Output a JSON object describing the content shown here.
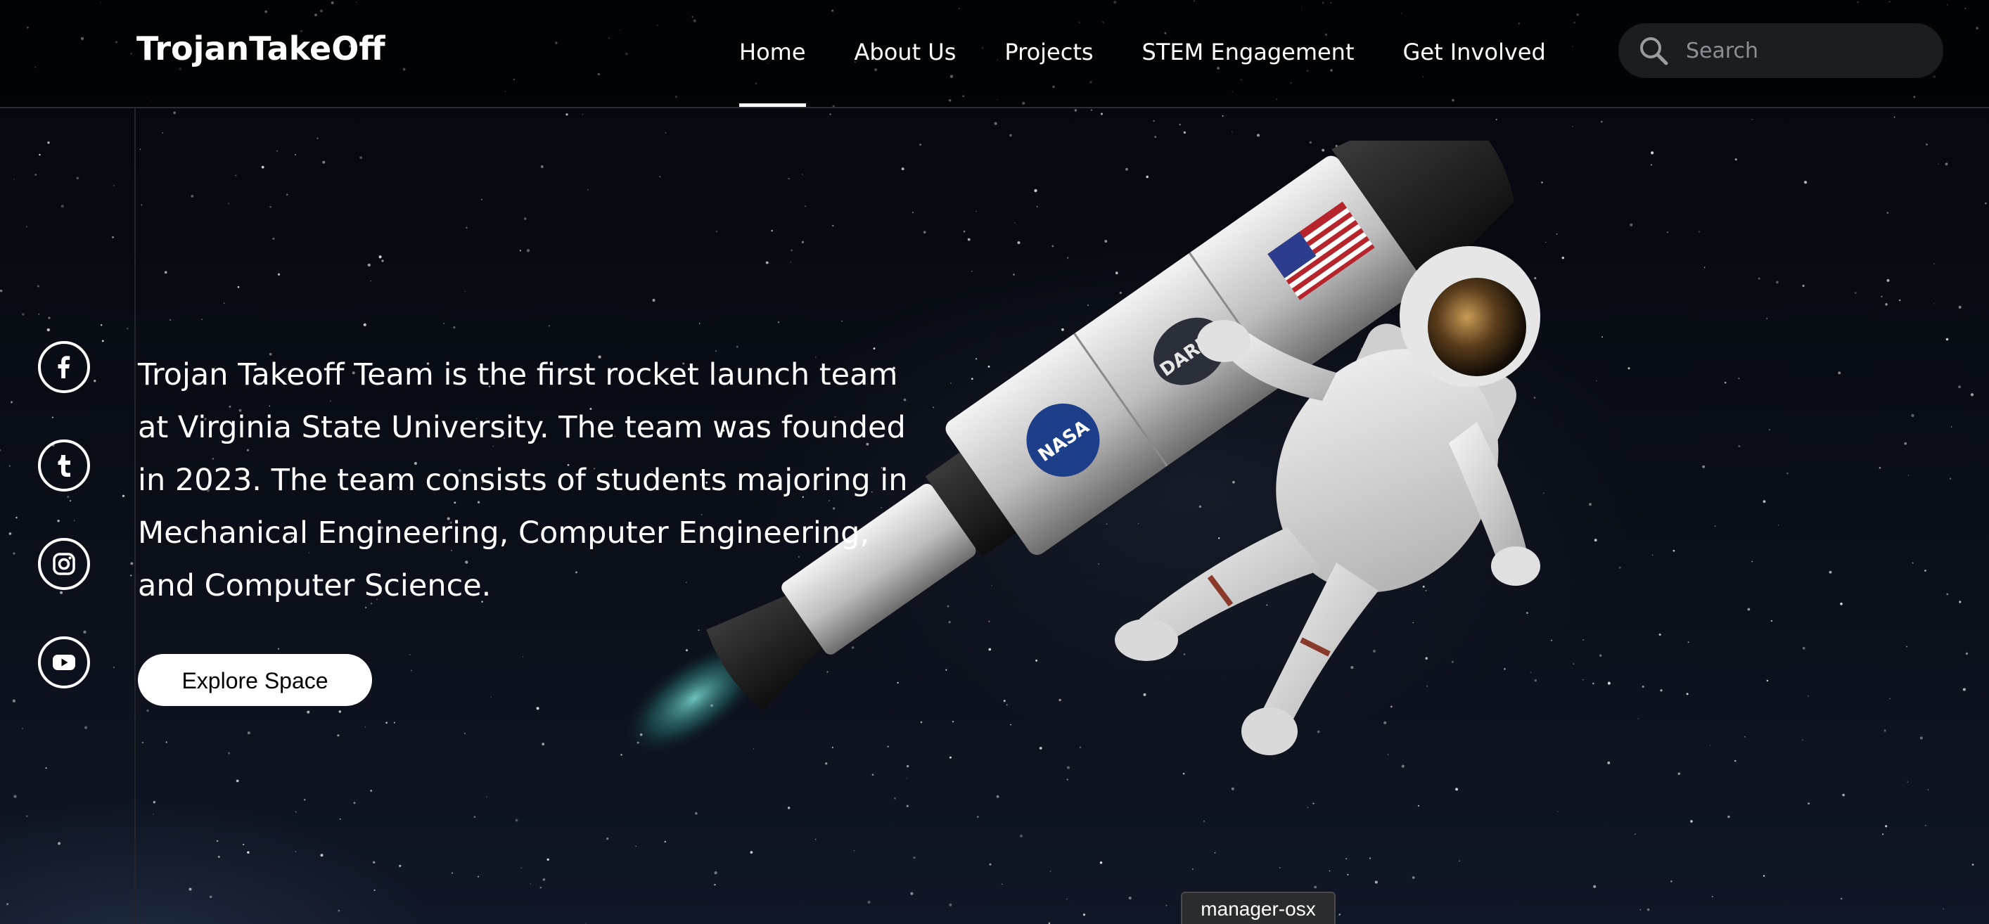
{
  "header": {
    "logo": "TrojanTakeOff",
    "nav": [
      {
        "label": "Home",
        "active": true
      },
      {
        "label": "About Us",
        "active": false
      },
      {
        "label": "Projects",
        "active": false
      },
      {
        "label": "STEM Engagement",
        "active": false
      },
      {
        "label": "Get Involved",
        "active": false
      }
    ],
    "search": {
      "placeholder": "Search",
      "value": "",
      "icon": "search-icon"
    }
  },
  "social": [
    {
      "name": "facebook",
      "icon": "facebook-icon",
      "glyph": "f"
    },
    {
      "name": "tumblr",
      "icon": "tumblr-icon",
      "glyph": "t"
    },
    {
      "name": "instagram",
      "icon": "instagram-icon",
      "glyph": ""
    },
    {
      "name": "youtube",
      "icon": "youtube-icon",
      "glyph": ""
    }
  ],
  "hero": {
    "lines": [
      "Trojan Takeoff Team is the first rocket launch team",
      "at Virginia State University. The team was founded",
      "in 2023. The team consists of students majoring in",
      "Mechanical Engineering, Computer Engineering,",
      "and Computer Science."
    ],
    "cta_label": "Explore Space"
  },
  "artwork": {
    "rocket_labels": [
      "NASA",
      "DARPA"
    ]
  },
  "tooltip": {
    "text": "manager-osx"
  },
  "colors": {
    "background": "#05070c",
    "header_bg": "#000000",
    "search_bg": "#1c1d21",
    "accent": "#ffffff"
  }
}
